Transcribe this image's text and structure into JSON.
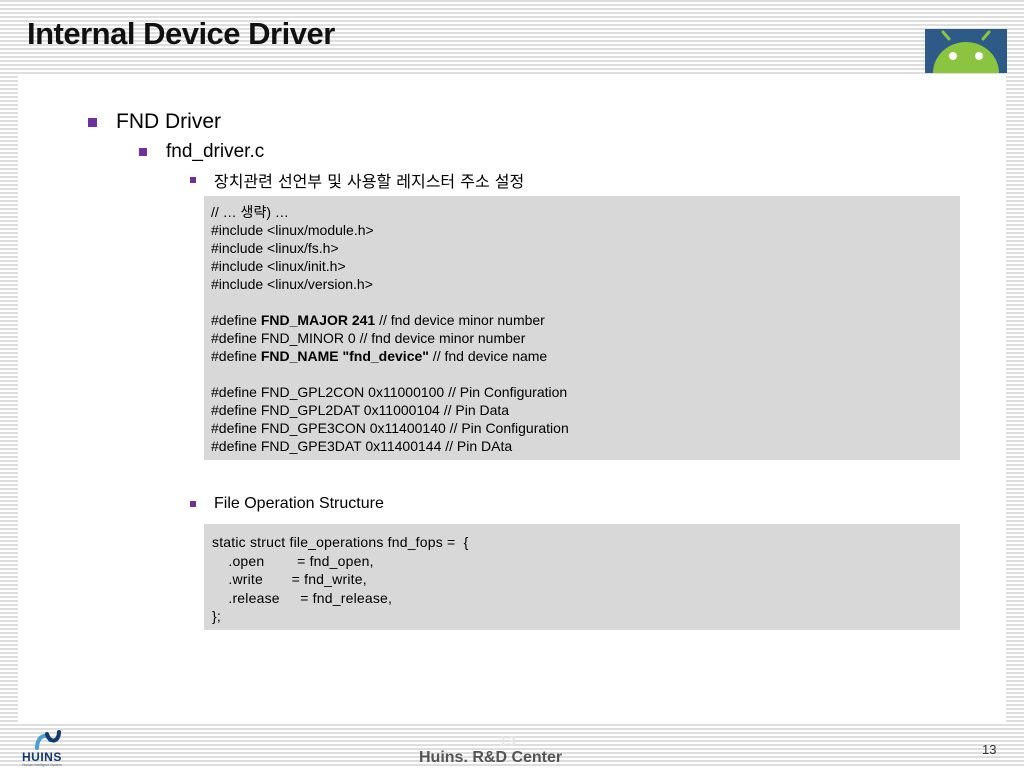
{
  "title": "Internal Device Driver",
  "bullets": {
    "level1": "FND Driver",
    "level2": "fnd_driver.c",
    "level3_registers": "장치관련 선언부 및 사용할 레지스터 주소 설정",
    "level3_fops": "File Operation Structure"
  },
  "code1": {
    "line1": "// … 생략) …",
    "line2": "#include <linux/module.h>",
    "line3": "#include <linux/fs.h>",
    "line4": "#include <linux/init.h>",
    "line5": "#include <linux/version.h>",
    "major": {
      "prefix": "#define ",
      "name": "FND_MAJOR 241",
      "suffix": " // fnd device minor number"
    },
    "minor": "#define FND_MINOR 0 // fnd device minor number",
    "devname": {
      "prefix": "#define ",
      "name": "FND_NAME \"fnd_device\"",
      "suffix": " // fnd device name"
    },
    "gpl2con": "#define FND_GPL2CON 0x11000100 // Pin Configuration",
    "gpl2dat": "#define FND_GPL2DAT 0x11000104 // Pin Data",
    "gpe3con": "#define FND_GPE3CON 0x11400140 // Pin Configuration",
    "gpe3dat": "#define FND_GPE3DAT 0x11400144 // Pin DAta"
  },
  "code2": {
    "line1": "static struct file_operations fnd_fops =  {",
    "line2": "    .open        = fnd_open,",
    "line3": "    .write       = fnd_write,",
    "line4": "    .release     = fnd_release,",
    "line5": "};"
  },
  "footer": {
    "logo_text": "HUINS",
    "logo_subtext": "Human Intelligent System",
    "center_text": "Huins. R&D Center",
    "ghost_number": "13",
    "page_number": "13"
  },
  "colors": {
    "bullet": "#6f2f9f",
    "code_background": "#d8d8d8",
    "android_green": "#8bc53f",
    "android_background": "#2d5a86"
  },
  "icons": {
    "corner_logo": "android-logo-icon",
    "footer_logo": "huins-logo-icon",
    "bullets": "square-bullet-icon"
  }
}
